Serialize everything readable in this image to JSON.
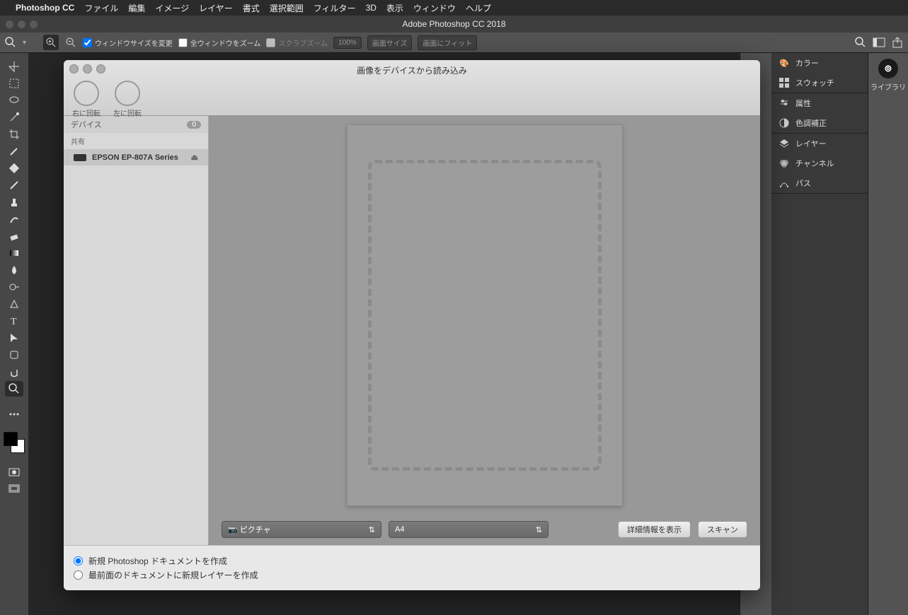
{
  "menubar": {
    "apple": "",
    "app": "Photoshop CC",
    "items": [
      "ファイル",
      "編集",
      "イメージ",
      "レイヤー",
      "書式",
      "選択範囲",
      "フィルター",
      "3D",
      "表示",
      "ウィンドウ",
      "ヘルプ"
    ]
  },
  "window": {
    "title": "Adobe Photoshop CC 2018"
  },
  "optionbar": {
    "resize_label": "ウィンドウサイズを変更",
    "allwin_label": "全ウィンドウをズーム",
    "scrubzoom_label": "スクラブズーム",
    "btn_100": "100%",
    "btn_fitscreen": "画面サイズ",
    "btn_fit": "画面にフィット"
  },
  "panels": {
    "color": "カラー",
    "swatch": "スウォッチ",
    "prop": "属性",
    "adjust": "色調補正",
    "layer": "レイヤー",
    "channel": "チャンネル",
    "path": "パス",
    "library": "ライブラリ"
  },
  "dialog": {
    "title": "画像をデバイスから読み込み",
    "rotate_right": "右に回転",
    "rotate_left": "左に回転",
    "side_device": "デバイス",
    "side_count": "0",
    "side_shared": "共有",
    "scanner": "EPSON EP-807A Series",
    "dest": "ピクチャ",
    "size": "A4",
    "btn_details": "詳細情報を表示",
    "btn_scan": "スキャン",
    "radio1": "新規 Photoshop ドキュメントを作成",
    "radio2": "最前面のドキュメントに新規レイヤーを作成"
  }
}
